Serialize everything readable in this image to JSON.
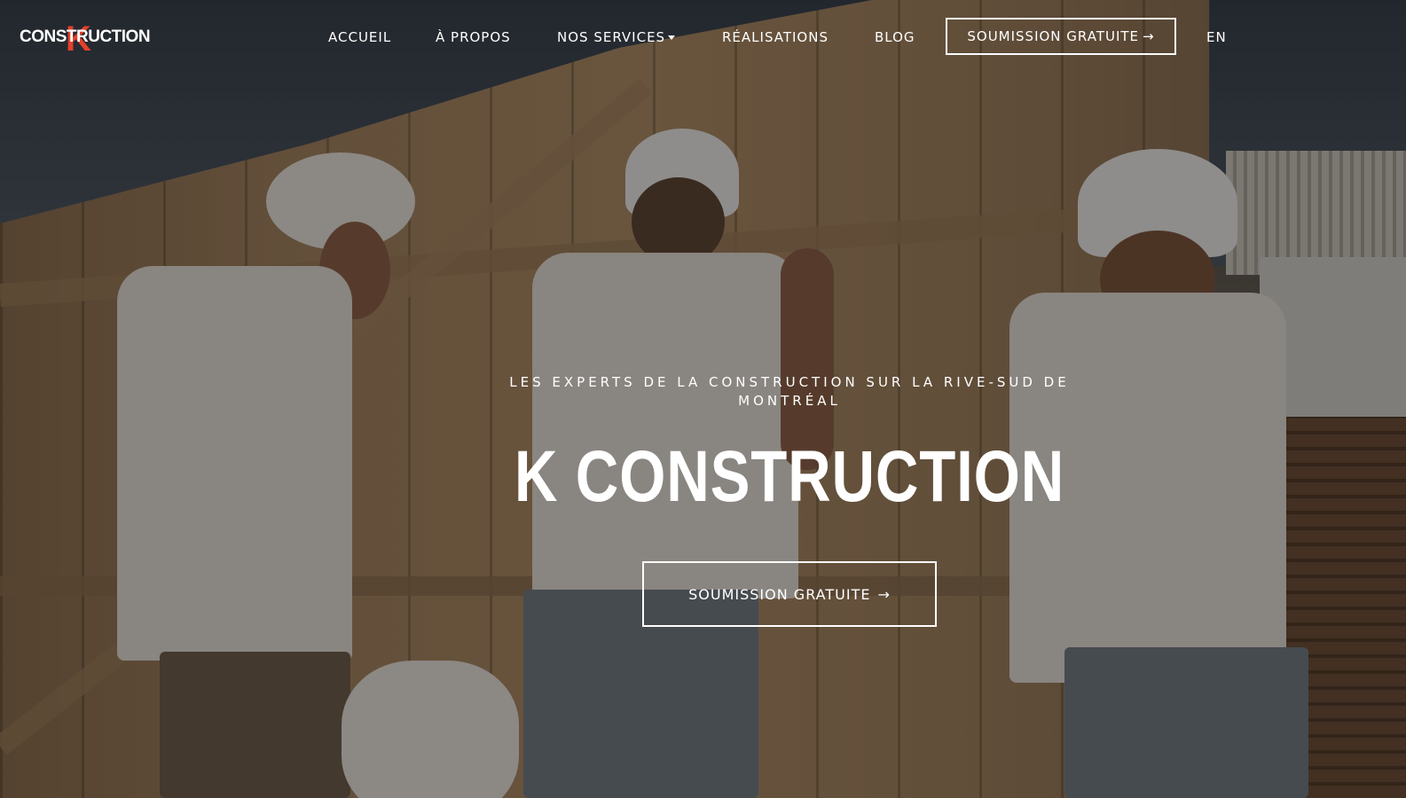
{
  "brand": {
    "logo_letter": "K",
    "logo_word": "CONSTRUCTION"
  },
  "nav": {
    "items": [
      {
        "label": "ACCUEIL"
      },
      {
        "label": "À PROPOS"
      },
      {
        "label": "NOS SERVICES"
      },
      {
        "label": "RÉALISATIONS"
      },
      {
        "label": "BLOG"
      }
    ],
    "cta_label": "SOUMISSION GRATUITE",
    "cta_icon": "arrow-right-icon",
    "language_label": "EN"
  },
  "hero": {
    "subtitle": "LES EXPERTS DE LA CONSTRUCTION SUR LA RIVE-SUD DE MONTRÉAL",
    "title": "K CONSTRUCTION",
    "cta_label": "SOUMISSION GRATUITE",
    "cta_icon": "arrow-right-icon"
  },
  "colors": {
    "accent": "#e3402a",
    "text": "#ffffff"
  }
}
